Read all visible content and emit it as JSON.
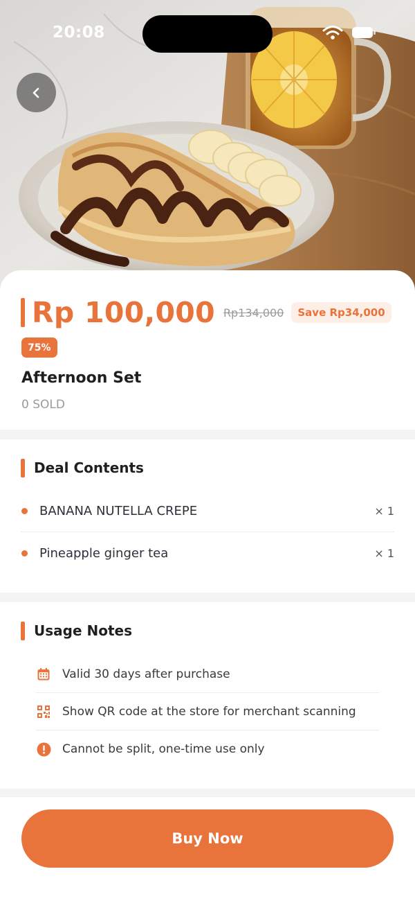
{
  "status_bar": {
    "time": "20:08"
  },
  "hero": {
    "image_alt": "Banana Nutella crepe with pineapple ginger tea"
  },
  "deal": {
    "price": "Rp 100,000",
    "original_price": "Rp134,000",
    "save_label": "Save Rp34,000",
    "discount_badge": "75%",
    "title": "Afternoon Set",
    "sold": "0 SOLD"
  },
  "deal_contents": {
    "title": "Deal Contents",
    "items": [
      {
        "name": "BANANA NUTELLA CREPE",
        "qty": "× 1"
      },
      {
        "name": "Pineapple ginger tea",
        "qty": "× 1"
      }
    ]
  },
  "usage_notes": {
    "title": "Usage Notes",
    "items": [
      {
        "icon": "calendar-icon",
        "text": "Valid 30 days after purchase"
      },
      {
        "icon": "qr-code-icon",
        "text": "Show QR code at the store for merchant scanning"
      },
      {
        "icon": "alert-icon",
        "text": "Cannot be split, one-time use only"
      }
    ]
  },
  "actions": {
    "buy_label": "Buy Now"
  },
  "colors": {
    "accent": "#e8733b",
    "accent_soft": "#fdeee6",
    "divider": "#f3f5f5"
  }
}
